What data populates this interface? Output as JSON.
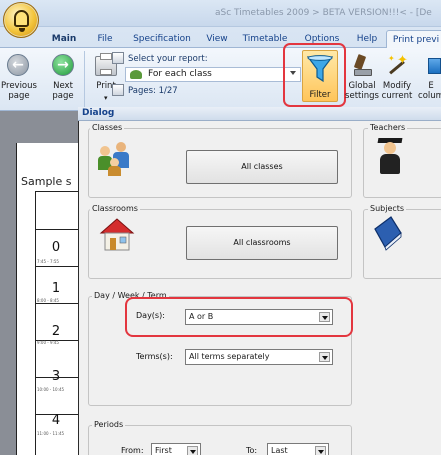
{
  "window": {
    "title": "aSc Timetables 2009 > BETA VERSION!!!< - [De"
  },
  "ribbon": {
    "tabs": [
      "Main",
      "File",
      "Specification",
      "View",
      "Timetable",
      "Options",
      "Help",
      "Print previ"
    ],
    "active_tab": "Print previ",
    "buttons": {
      "previous_page": "Previous\npage",
      "next_page": "Next\npage",
      "print": "Print",
      "filter": "Filter",
      "global_settings": "Global\nsettings",
      "modify_current": "Modify\ncurrent",
      "extra": "E\ncolum"
    },
    "report": {
      "select_label": "Select your report:",
      "selected_value": "For each class",
      "pages": "Pages: 1/27"
    }
  },
  "document_preview": {
    "title": "Sample s",
    "rows": [
      {
        "number": "0",
        "time": "7:45 - 7:55"
      },
      {
        "number": "1",
        "time": "8:00 - 8:45"
      },
      {
        "number": "2",
        "time": "9:00 - 9:45"
      },
      {
        "number": "3",
        "time": "10:00 - 10:45"
      },
      {
        "number": "4",
        "time": "11:00 - 11:45"
      }
    ]
  },
  "dialog": {
    "title": "Dialog",
    "classes": {
      "label": "Classes",
      "button": "All classes"
    },
    "teachers": {
      "label": "Teachers"
    },
    "classrooms": {
      "label": "Classrooms",
      "button": "All classrooms"
    },
    "subjects": {
      "label": "Subjects"
    },
    "day_week_term": {
      "label": "Day / Week / Term",
      "days_label": "Day(s):",
      "days_value": "A or B",
      "terms_label": "Terms(s):",
      "terms_value": "All terms separately"
    },
    "periods": {
      "label": "Periods",
      "from_label": "From:",
      "from_value": "First",
      "to_label": "To:",
      "to_value": "Last"
    }
  },
  "colors": {
    "highlight": "#e3363f",
    "ribbon_text": "#15428b",
    "filter_active": "#ffc55a"
  }
}
